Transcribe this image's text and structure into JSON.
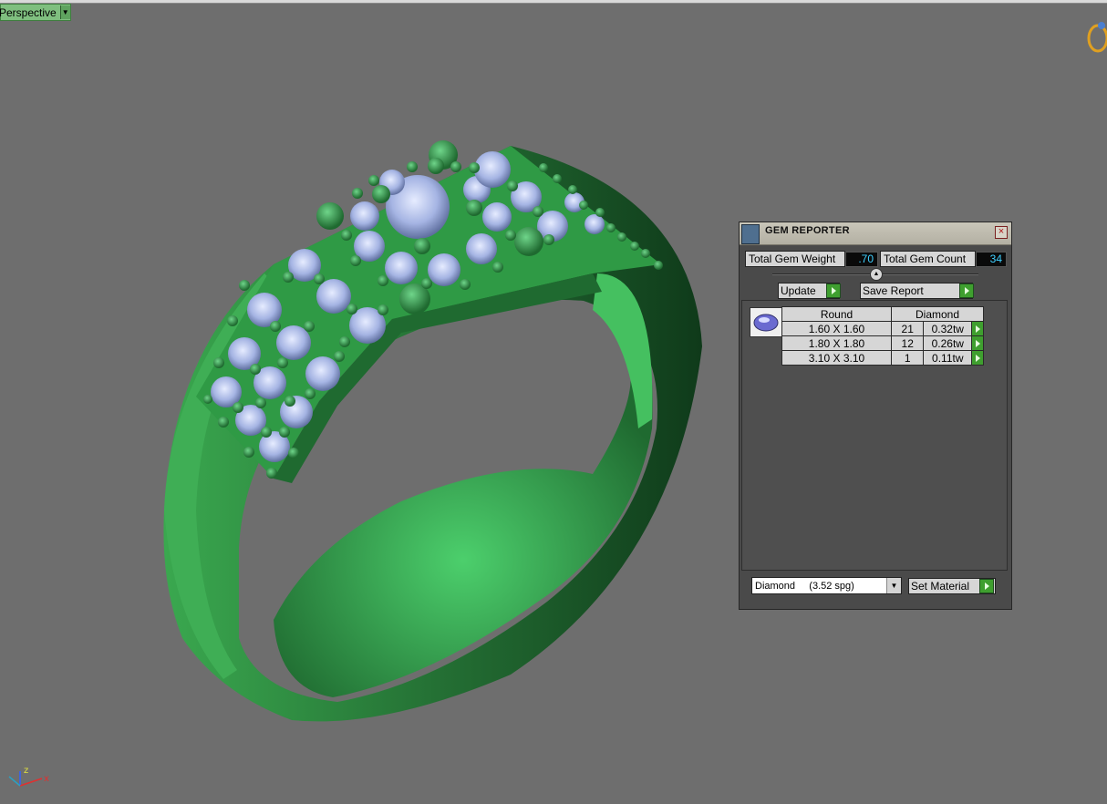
{
  "viewport": {
    "label": "Perspective",
    "dropdown_icon": "chevron-down-icon"
  },
  "axes": {
    "z": "z",
    "x": "x"
  },
  "scene": {
    "background_color": "#6e6e6e",
    "ring_color": "#3fae55",
    "gem_color": "#a9b8e6"
  },
  "gem_reporter": {
    "title": "GEM REPORTER",
    "total_weight_label": "Total Gem Weight",
    "total_weight_value": ".70",
    "total_count_label": "Total Gem Count",
    "total_count_value": "34",
    "update_label": "Update",
    "save_report_label": "Save Report",
    "table": {
      "shape_header": "Round",
      "material_header": "Diamond",
      "rows": [
        {
          "size": "1.60 X 1.60",
          "count": "21",
          "weight": "0.32tw"
        },
        {
          "size": "1.80 X 1.80",
          "count": "12",
          "weight": "0.26tw"
        },
        {
          "size": "3.10 X 3.10",
          "count": "1",
          "weight": "0.11tw"
        }
      ]
    },
    "material_select": "Diamond     (3.52 spg)",
    "set_material_label": "Set Material"
  }
}
